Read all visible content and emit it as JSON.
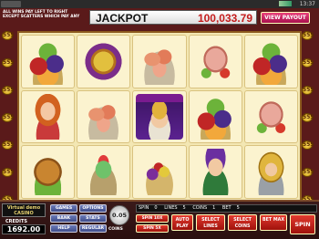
{
  "status_bar": {
    "clock": "13:37"
  },
  "info_text": "ALL WINS PAY LEFT TO RIGHT EXCEPT SCATTERS WHICH PAY ANY",
  "jackpot": {
    "label": "JACKPOT",
    "value": "100,033.79"
  },
  "view_payout_label": "VIEW PAYOUT",
  "line_markers": {
    "left": [
      "555",
      "555",
      "555",
      "555",
      "555",
      "555",
      "555"
    ],
    "right": [
      "555",
      "555",
      "555",
      "555",
      "555",
      "555",
      "555"
    ]
  },
  "reels": [
    [
      "fruit",
      "dragon",
      "shrimp",
      "ham",
      "fruit"
    ],
    [
      "lady",
      "shrimp",
      "king",
      "fruit",
      "ham"
    ],
    [
      "chicken",
      "jelly",
      "bowl",
      "jester",
      "knight"
    ]
  ],
  "panel": {
    "logo_text": "Virtual demo CASINO",
    "credits_label": "CREDITS",
    "credits_value": "1692.00",
    "buttons": {
      "games": "GAMES",
      "options": "OPTIONS",
      "bank": "BANK",
      "stats": "STATS",
      "help": "HELP",
      "regular": "REGULAR"
    },
    "coin_value": "0.05",
    "coins_label": "COINS",
    "spin_label": "SPIN",
    "spin_value": "0",
    "lines_label": "LINES",
    "lines_value": "5",
    "coins_bet_label": "COINS",
    "coins_bet_value": "1",
    "bet_label": "BET",
    "bet_value": "5",
    "spin_10x": "SPIN 10X",
    "spin_5x": "SPIN 5X",
    "auto_play": "AUTO PLAY",
    "select_lines": "SELECT LINES",
    "select_coins": "SELECT COINS",
    "bet_max": "BET MAX",
    "spin": "SPIN"
  }
}
